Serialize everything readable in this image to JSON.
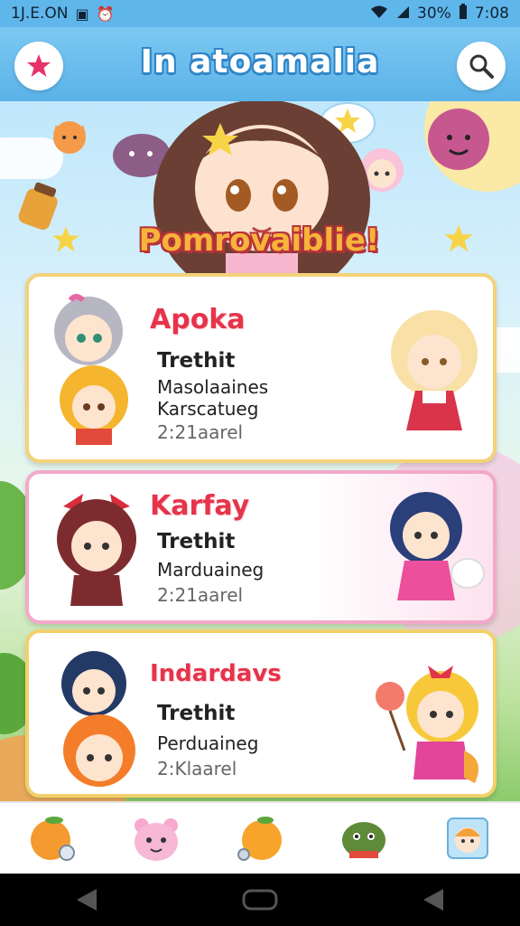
{
  "status_bar": {
    "time_left": "1J.E.ON",
    "battery": "30%",
    "clock": "7:08"
  },
  "header": {
    "title": "In atoamalia",
    "left_icon": "star-icon",
    "right_icon": "search-icon"
  },
  "banner": {
    "text": "Pomrovaiblie!"
  },
  "cards": [
    {
      "name": "Apoka",
      "lines": [
        "Trethit",
        "Masolaaines",
        "Karscatueg",
        "2:21aarel"
      ]
    },
    {
      "name": "Karfay",
      "lines": [
        "Trethit",
        "Marduaineg",
        "2:21aarel"
      ]
    },
    {
      "name": "Indardavs",
      "lines": [
        "Trethit",
        "Perduaineg",
        "2:Klaarel"
      ]
    }
  ],
  "tabs": [
    {
      "icon": "orange-fruit-icon"
    },
    {
      "icon": "pink-bear-icon"
    },
    {
      "icon": "orange-icon"
    },
    {
      "icon": "green-frog-icon"
    },
    {
      "icon": "photo-character-icon"
    }
  ],
  "navbar": {
    "icons": [
      "back-icon",
      "home-icon",
      "recents-icon"
    ]
  },
  "colors": {
    "header_blue": "#5ab2e8",
    "card_name_red": "#e6344b",
    "banner_yellow": "#f6b43a"
  }
}
